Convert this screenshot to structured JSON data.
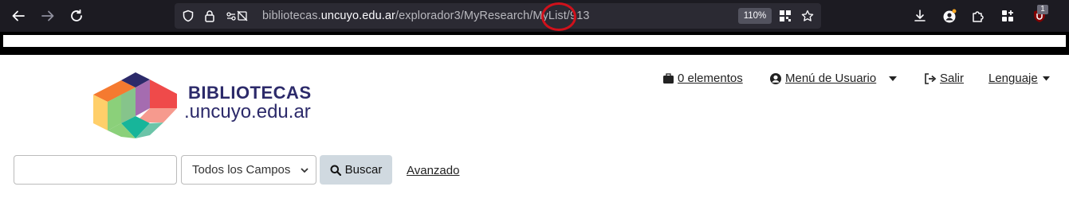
{
  "browser": {
    "url": {
      "prefix": "bibliotecas.",
      "domain": "uncuyo.edu.ar",
      "path": "/explorador3/MyResearch/MyList/913"
    },
    "zoom": "110%",
    "badge_count": "1",
    "icons": [
      "back-icon",
      "forward-icon",
      "reload-icon",
      "shield-icon",
      "lock-icon",
      "permissions-icon",
      "extensions-grid-icon",
      "bookmark-star-icon",
      "download-icon",
      "account-icon",
      "extensions-puzzle-icon",
      "addon-icon",
      "ublock-icon"
    ]
  },
  "site": {
    "brand_top": "BIBLIOTECAS",
    "brand_bottom": ".uncuyo.edu.ar"
  },
  "nav": {
    "cart": "0 elementos",
    "user_menu": "Menú de Usuario",
    "logout": "Salir",
    "language": "Lenguaje"
  },
  "search": {
    "input_value": "",
    "field_select": "Todos los Campos",
    "button": "Buscar",
    "advanced": "Avanzado"
  },
  "colors": {
    "brand": "#2c2a6a",
    "annotation_ring": "#d0111b"
  }
}
